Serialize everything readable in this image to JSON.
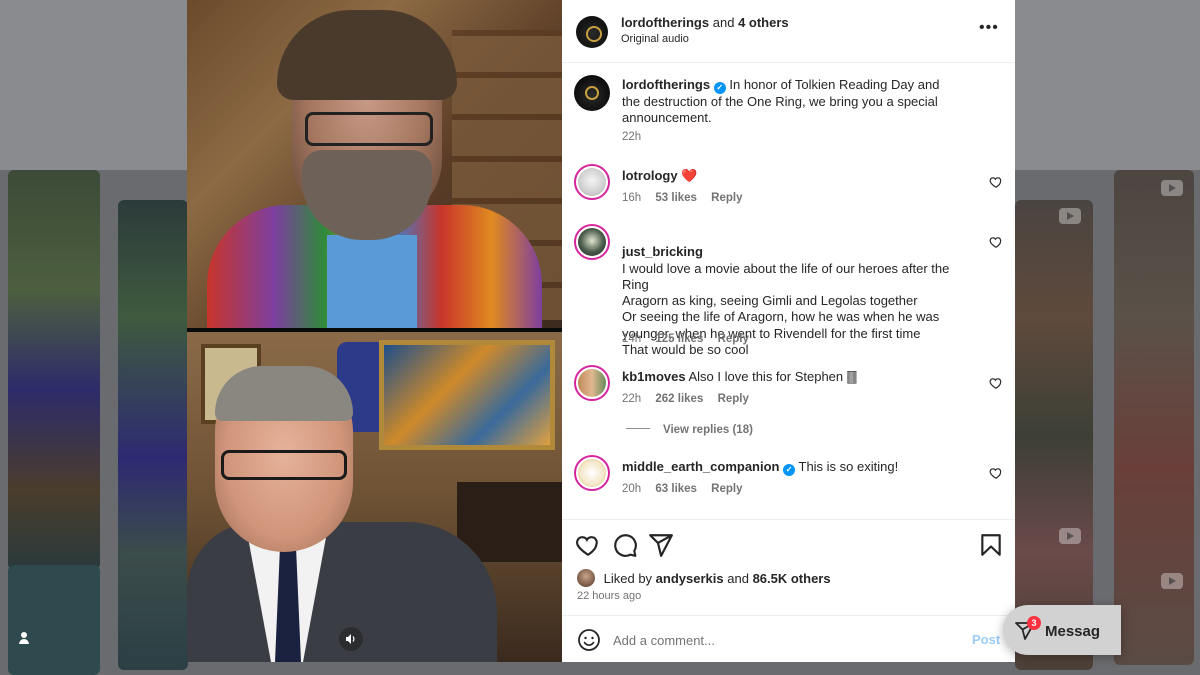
{
  "post": {
    "author": "lordoftherings",
    "collab_suffix": "and",
    "collab_others": "4 others",
    "audio": "Original audio"
  },
  "caption": {
    "username": "lordoftherings",
    "text": "In honor of Tolkien Reading Day and the destruction of the One Ring, we bring you a special announcement.",
    "time": "22h"
  },
  "comments": [
    {
      "username": "lotrology",
      "text": "❤️",
      "time": "16h",
      "likes": "53 likes",
      "reply": "Reply"
    },
    {
      "username": "just_bricking",
      "text": "I would love a movie about the life of our heroes after the Ring\nAragorn as king, seeing Gimli and Legolas together\nOr seeing the life of Aragorn, how he was when he was younger, when he went to Rivendell for the first time\nThat would be so cool",
      "time": "14h",
      "likes": "125 likes",
      "reply": "Reply"
    },
    {
      "username": "kb1moves",
      "text": "Also I love this for Stephen 🀫",
      "time": "22h",
      "likes": "262 likes",
      "reply": "Reply",
      "view_replies": "View replies (18)"
    },
    {
      "username": "middle_earth_companion",
      "text": "This is so exiting!",
      "time": "20h",
      "likes": "63 likes",
      "reply": "Reply"
    }
  ],
  "likes": {
    "prefix": "Liked by",
    "user": "andyserkis",
    "joiner": "and",
    "others": "86.5K others"
  },
  "time_ago": "22 hours ago",
  "comment_box": {
    "placeholder": "Add a comment...",
    "post_label": "Post"
  },
  "messages": {
    "label": "Messag",
    "badge": "3"
  },
  "icons": {
    "more": "more-options-icon",
    "like": "heart-icon",
    "comment": "comment-icon",
    "share": "share-icon",
    "save": "bookmark-icon",
    "emoji": "emoji-icon",
    "tag": "person-tag-icon",
    "mute": "speaker-icon"
  },
  "colors": {
    "verified": "#0095f6",
    "post_button": "#9ccdf7",
    "story_ring": "#d6249f",
    "badge": "#ff3040"
  }
}
